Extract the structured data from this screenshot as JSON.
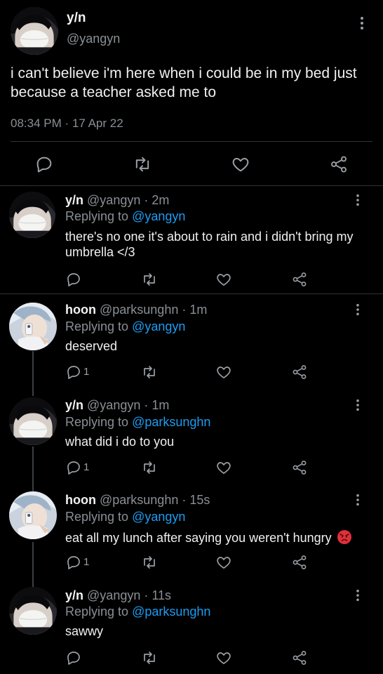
{
  "main_tweet": {
    "name": "y/n",
    "handle": "@yangyn",
    "text": "i can't believe i'm here when i could be in my bed just because a teacher asked me to",
    "timestamp": "08:34 PM · 17 Apr 22"
  },
  "replies": [
    {
      "name": "y/n",
      "meta": "@yangyn · 2m",
      "replying_prefix": "Replying to ",
      "replying_to": "@yangyn",
      "text": "there's no one it's about to rain and i didn't bring my umbrella </3",
      "reply_count": ""
    },
    {
      "name": "hoon",
      "meta": "@parksunghn · 1m",
      "replying_prefix": "Replying to ",
      "replying_to": "@yangyn",
      "text": "deserved",
      "reply_count": "1"
    },
    {
      "name": "y/n",
      "meta": "@yangyn · 1m",
      "replying_prefix": "Replying to ",
      "replying_to": "@parksunghn",
      "text": "what did i do to you",
      "reply_count": "1"
    },
    {
      "name": "hoon",
      "meta": "@parksunghn · 15s",
      "replying_prefix": "Replying to ",
      "replying_to": "@yangyn",
      "text": "eat all my lunch after saying you weren't hungry",
      "reply_count": "1"
    },
    {
      "name": "y/n",
      "meta": "@yangyn · 11s",
      "replying_prefix": "Replying to ",
      "replying_to": "@parksunghn",
      "text": "sawwy",
      "reply_count": ""
    }
  ],
  "icons": {
    "reply": "reply-icon",
    "retweet": "retweet-icon",
    "like": "heart-icon",
    "share": "share-icon",
    "more": "more-icon",
    "emoji": "angry-face-emoji"
  },
  "colors": {
    "background": "#000000",
    "link": "#1d9bf0",
    "muted": "#8a8f95",
    "divider": "#2f3336"
  }
}
